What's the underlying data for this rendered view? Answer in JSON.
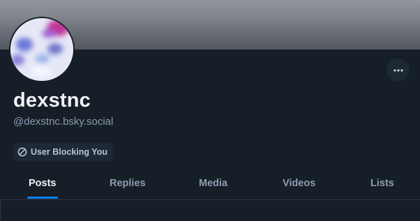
{
  "profile": {
    "display_name": "dexstnc",
    "handle": "@dexstnc.bsky.social",
    "block_badge": {
      "label": "User Blocking You",
      "icon": "block-icon"
    },
    "more_icon": "ellipsis-icon"
  },
  "tabs": [
    {
      "label": "Posts",
      "active": true
    },
    {
      "label": "Replies",
      "active": false
    },
    {
      "label": "Media",
      "active": false
    },
    {
      "label": "Videos",
      "active": false
    },
    {
      "label": "Lists",
      "active": false
    }
  ],
  "colors": {
    "background": "#161e27",
    "accent": "#1083fe",
    "text_primary": "#f1f3f5",
    "text_secondary": "#8c9cb0"
  }
}
